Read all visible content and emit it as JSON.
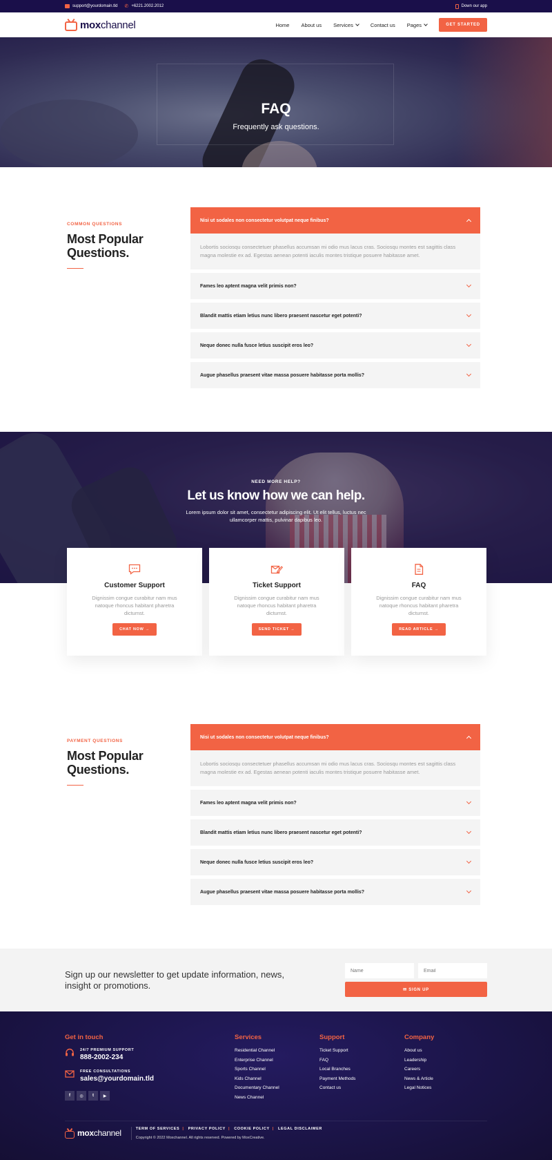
{
  "topbar": {
    "email": "support@yourdomain.tld",
    "phone": "+6221.2002.2012",
    "app": "Down our app"
  },
  "brand": {
    "bold": "mox",
    "rest": "channel"
  },
  "nav": {
    "home": "Home",
    "about": "About us",
    "services": "Services",
    "contact": "Contact us",
    "pages": "Pages",
    "cta": "GET STARTED"
  },
  "hero": {
    "title": "FAQ",
    "subtitle": "Frequently ask questions."
  },
  "faq1": {
    "eyebrow": "COMMON QUESTIONS",
    "title": "Most Popular Questions.",
    "items": [
      {
        "q": "Nisi ut sodales non consectetur volutpat neque finibus?",
        "a": "Lobortis sociosqu consectetuer phasellus accumsan mi odio mus lacus cras. Sociosqu montes est sagittis class magna molestie ex ad. Egestas aenean potenti iaculis montes tristique posuere habitasse amet."
      },
      {
        "q": "Fames leo aptent magna velit primis non?"
      },
      {
        "q": "Blandit mattis etiam letius nunc libero praesent nascetur eget potenti?"
      },
      {
        "q": "Neque donec nulla fusce letius suscipit eros leo?"
      },
      {
        "q": "Augue phasellus praesent vitae massa posuere habitasse porta mollis?"
      }
    ]
  },
  "help": {
    "kicker": "NEED MORE HELP?",
    "title": "Let us know how we can help.",
    "text": "Lorem ipsum dolor sit amet, consectetur adipiscing elit. Ut elit tellus, luctus nec ullamcorper mattis, pulvinar dapibus leo.",
    "cards": [
      {
        "title": "Customer Support",
        "text": "Dignissim congue curabitur nam mus natoque rhoncus habitant pharetra dictumst.",
        "button": "CHAT NOW →",
        "icon": "chat-icon"
      },
      {
        "title": "Ticket Support",
        "text": "Dignissim congue curabitur nam mus natoque rhoncus habitant pharetra dictumst.",
        "button": "SEND TICKET →",
        "icon": "ticket-edit-icon"
      },
      {
        "title": "FAQ",
        "text": "Dignissim congue curabitur nam mus natoque rhoncus habitant pharetra dictumst.",
        "button": "READ ARTICLE →",
        "icon": "document-icon"
      }
    ]
  },
  "faq2": {
    "eyebrow": "PAYMENT QUESTIONS",
    "title": "Most Popular Questions.",
    "items": [
      {
        "q": "Nisi ut sodales non consectetur volutpat neque finibus?",
        "a": "Lobortis sociosqu consectetuer phasellus accumsan mi odio mus lacus cras. Sociosqu montes est sagittis class magna molestie ex ad. Egestas aenean potenti iaculis montes tristique posuere habitasse amet."
      },
      {
        "q": "Fames leo aptent magna velit primis non?"
      },
      {
        "q": "Blandit mattis etiam letius nunc libero praesent nascetur eget potenti?"
      },
      {
        "q": "Neque donec nulla fusce letius suscipit eros leo?"
      },
      {
        "q": "Augue phasellus praesent vitae massa posuere habitasse porta mollis?"
      }
    ]
  },
  "newsletter": {
    "text": "Sign up our newsletter to get update information, news, insight or promotions.",
    "name_placeholder": "Name",
    "email_placeholder": "Email",
    "button": "✉ SIGN UP"
  },
  "footer": {
    "get_in_touch": "Get in touch",
    "support_label": "24/7 PREMIUM SUPPORT",
    "support_phone": "888-2002-234",
    "consult_label": "FREE CONSULTATIONS",
    "consult_email": "sales@yourdomain.tld",
    "social": [
      "f",
      "◎",
      "t",
      "▶"
    ],
    "columns": [
      {
        "title": "Services",
        "links": [
          "Residential Channel",
          "Enterprise Channel",
          "Sports Channel",
          "Kids Channel",
          "Documentary Channel",
          "News Channel"
        ]
      },
      {
        "title": "Support",
        "links": [
          "Ticket Support",
          "FAQ",
          "Local Branches",
          "Payment Methods",
          "Contact us"
        ]
      },
      {
        "title": "Company",
        "links": [
          "About us",
          "Leadership",
          "Careers",
          "News & Article",
          "Legal Notices"
        ]
      }
    ],
    "legal": [
      "TERM OF SERVICES",
      "PRIVACY POLICY",
      "COOKIE POLICY",
      "LEGAL DISCLAIMER"
    ],
    "copyright": "Copyright © 2022 Moxchannel. All rights reserved. Powered by MoxCreative."
  },
  "colors": {
    "accent": "#f26344",
    "navy": "#1a0f4a"
  }
}
